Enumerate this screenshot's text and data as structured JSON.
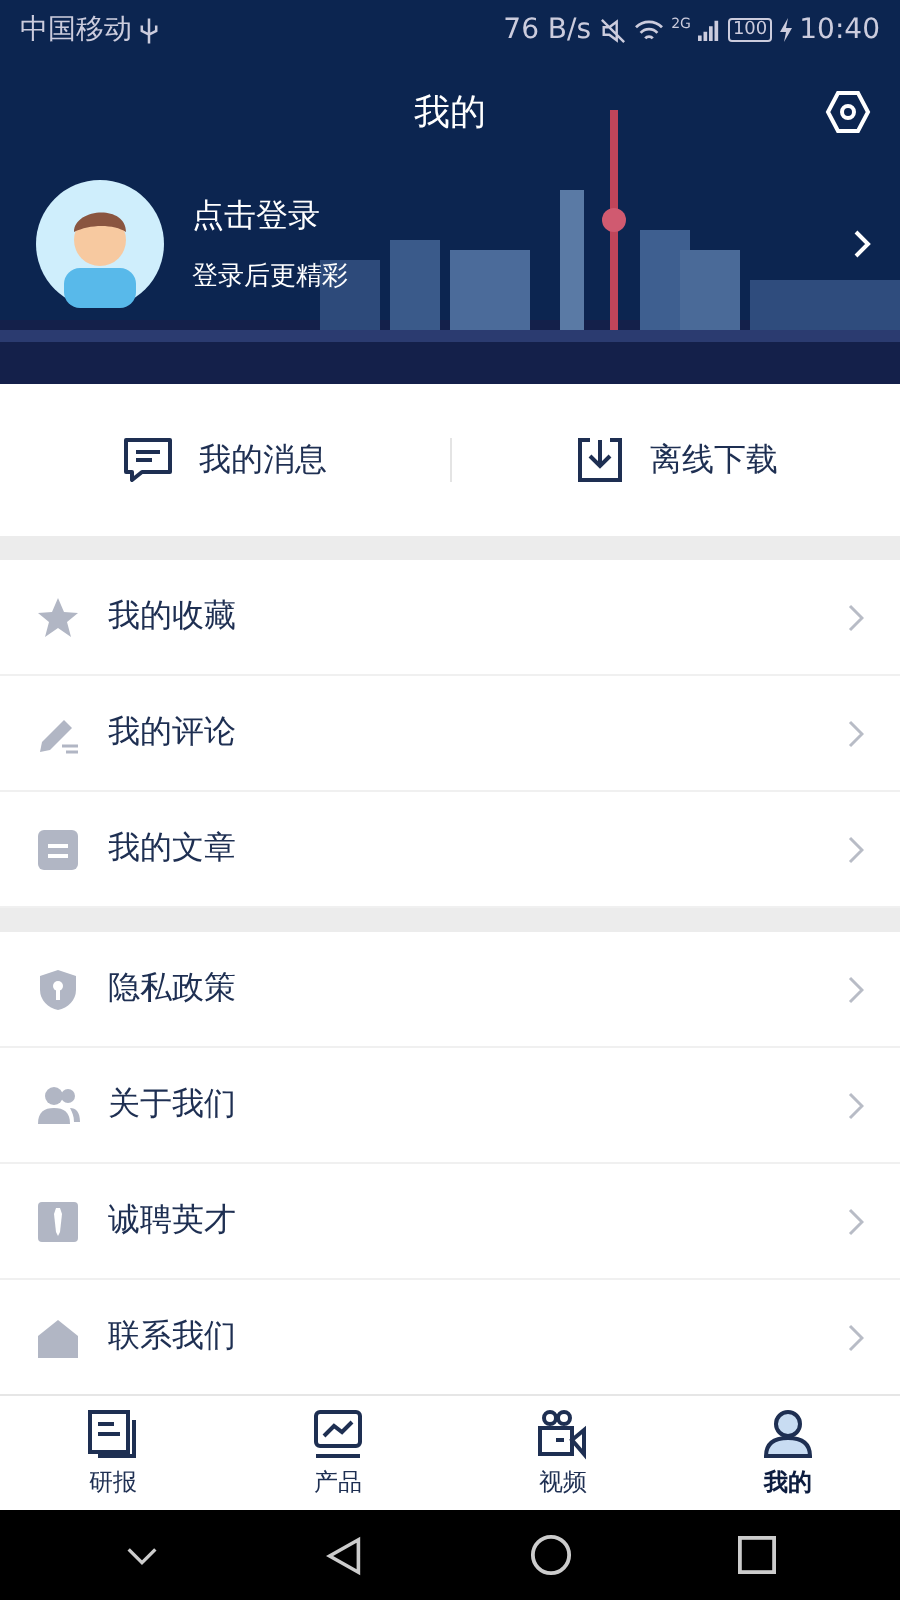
{
  "status_bar": {
    "carrier": "中国移动",
    "speed": "76 B/s",
    "network": "2G",
    "battery": "100",
    "time": "10:40"
  },
  "header": {
    "title": "我的",
    "login": "点击登录",
    "subtitle": "登录后更精彩"
  },
  "shortcuts": [
    {
      "label": "我的消息"
    },
    {
      "label": "离线下载"
    }
  ],
  "menu_groups": [
    [
      {
        "label": "我的收藏"
      },
      {
        "label": "我的评论"
      },
      {
        "label": "我的文章"
      }
    ],
    [
      {
        "label": "隐私政策"
      },
      {
        "label": "关于我们"
      },
      {
        "label": "诚聘英才"
      },
      {
        "label": "联系我们"
      }
    ]
  ],
  "tabs": [
    {
      "label": "研报",
      "selected": false
    },
    {
      "label": "产品",
      "selected": false
    },
    {
      "label": "视频",
      "selected": false
    },
    {
      "label": "我的",
      "selected": true
    }
  ]
}
